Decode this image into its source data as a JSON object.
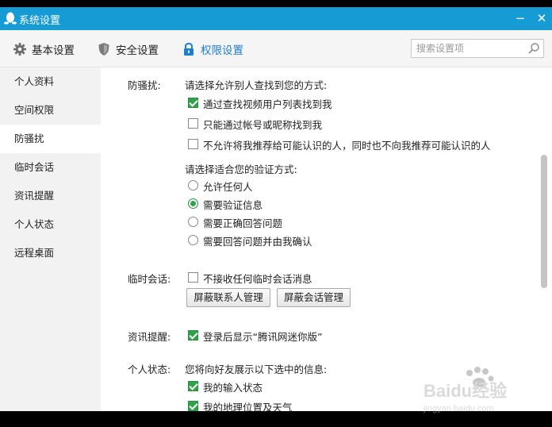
{
  "window": {
    "title": "系统设置",
    "minimize": "−",
    "close": "✕"
  },
  "toolbar": {
    "tabs": [
      {
        "label": "基本设置",
        "icon": "gear-icon"
      },
      {
        "label": "安全设置",
        "icon": "shield-icon"
      },
      {
        "label": "权限设置",
        "icon": "lock-icon",
        "active": true
      }
    ],
    "search": {
      "placeholder": "搜索设置项",
      "value": ""
    }
  },
  "sidebar": {
    "items": [
      {
        "label": "个人资料"
      },
      {
        "label": "空间权限"
      },
      {
        "label": "防骚扰",
        "active": true
      },
      {
        "label": "临时会话"
      },
      {
        "label": "资讯提醒"
      },
      {
        "label": "个人状态"
      },
      {
        "label": "远程桌面"
      }
    ]
  },
  "anti_harass": {
    "label": "防骚扰:",
    "find_prompt": "请选择允许别人查找到您的方式:",
    "find_options": [
      {
        "text": "通过查找视频用户列表找到我",
        "checked": true
      },
      {
        "text": "只能通过帐号或昵称找到我",
        "checked": false
      },
      {
        "text": "不允许将我推荐给可能认识的人，同时也不向我推荐可能认识的人",
        "checked": false
      }
    ],
    "verify_prompt": "请选择适合您的验证方式:",
    "verify_options": [
      {
        "text": "允许任何人",
        "selected": false
      },
      {
        "text": "需要验证信息",
        "selected": true
      },
      {
        "text": "需要正确回答问题",
        "selected": false
      },
      {
        "text": "需要回答问题并由我确认",
        "selected": false
      }
    ]
  },
  "temp_session": {
    "label": "临时会话:",
    "option": {
      "text": "不接收任何临时会话消息",
      "checked": false
    },
    "buttons": {
      "block_contacts": "屏蔽联系人管理",
      "block_sessions": "屏蔽会话管理"
    }
  },
  "news": {
    "label": "资讯提醒:",
    "option": {
      "text": "登录后显示“腾讯网迷你版”",
      "checked": true
    }
  },
  "status": {
    "label": "个人状态:",
    "prompt": "您将向好友展示以下选中的信息:",
    "options": [
      {
        "text": "我的输入状态",
        "checked": true
      },
      {
        "text": "我的地理位置及天气",
        "checked": true
      }
    ]
  },
  "watermark": {
    "brand": "Baidu经验",
    "url": "jingyan.baidu.com"
  },
  "colors": {
    "titlebar": "#169bd5",
    "active_tab": "#1f7fcb",
    "check_green": "#2fa34a"
  }
}
